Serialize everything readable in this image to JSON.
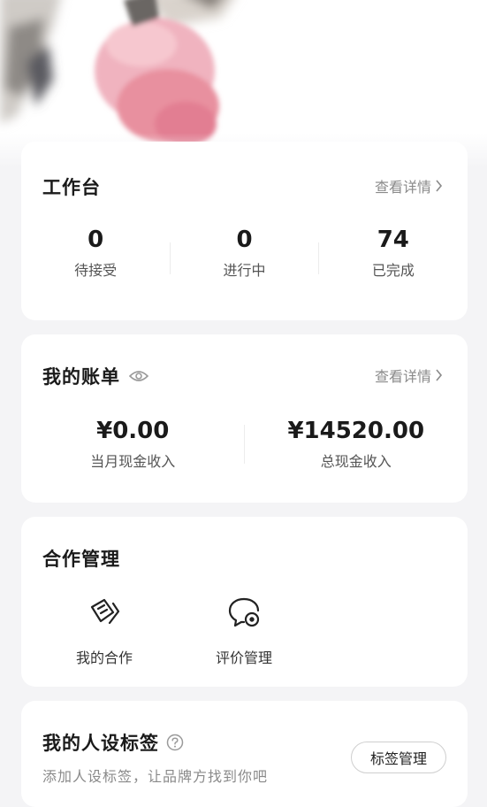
{
  "workbench": {
    "title": "工作台",
    "detail_link": "查看详情",
    "stats": [
      {
        "value": "0",
        "label": "待接受"
      },
      {
        "value": "0",
        "label": "进行中"
      },
      {
        "value": "74",
        "label": "已完成"
      }
    ]
  },
  "bill": {
    "title": "我的账单",
    "detail_link": "查看详情",
    "stats": [
      {
        "value": "¥0.00",
        "label": "当月现金收入"
      },
      {
        "value": "¥14520.00",
        "label": "总现金收入"
      }
    ]
  },
  "cooperation": {
    "title": "合作管理",
    "items": [
      {
        "label": "我的合作",
        "icon": "cooperation-icon"
      },
      {
        "label": "评价管理",
        "icon": "review-icon"
      }
    ]
  },
  "persona_tags": {
    "title": "我的人设标签",
    "subtitle": "添加人设标签，让品牌方找到你吧",
    "manage_button": "标签管理"
  }
}
